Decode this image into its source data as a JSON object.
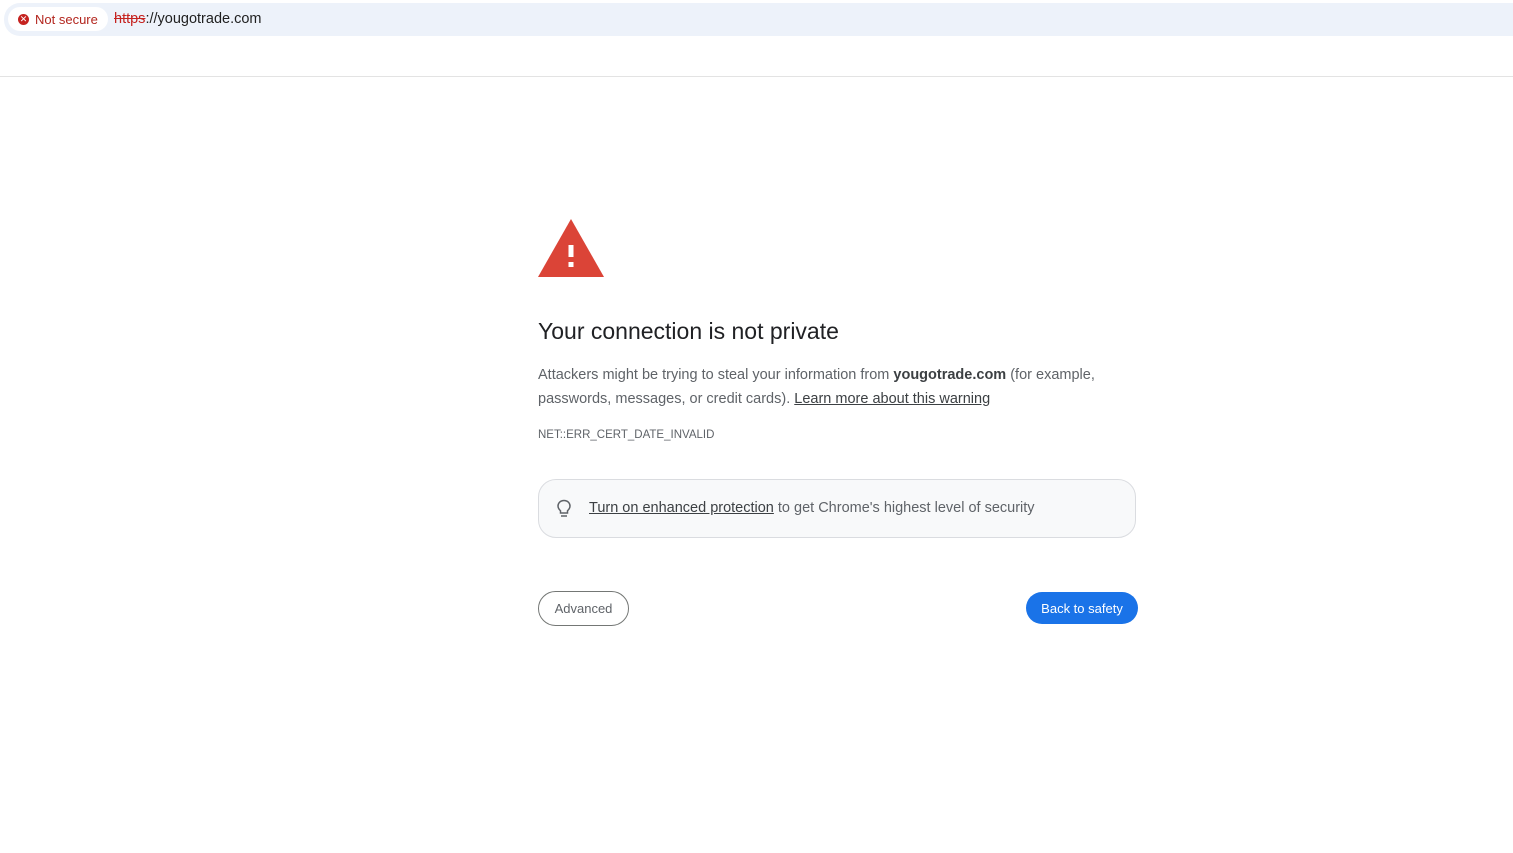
{
  "browser": {
    "security_chip_label": "Not secure",
    "url_scheme": "https",
    "url_rest": "://yougotrade.com",
    "chip_color": "#c5221f"
  },
  "interstitial": {
    "icon": "warning-triangle-icon",
    "icon_color": "#db4437",
    "heading": "Your connection is not private",
    "message_prefix": "Attackers might be trying to steal your information from ",
    "message_domain": "yougotrade.com",
    "message_suffix": " (for example, passwords, messages, or credit cards). ",
    "learn_more_label": "Learn more about this warning",
    "error_code": "NET::ERR_CERT_DATE_INVALID",
    "promo": {
      "icon": "lightbulb-icon",
      "link_label": "Turn on enhanced protection",
      "text": " to get Chrome's highest level of security"
    },
    "advanced_label": "Advanced",
    "back_label": "Back to safety",
    "primary_color": "#1a73e8"
  }
}
